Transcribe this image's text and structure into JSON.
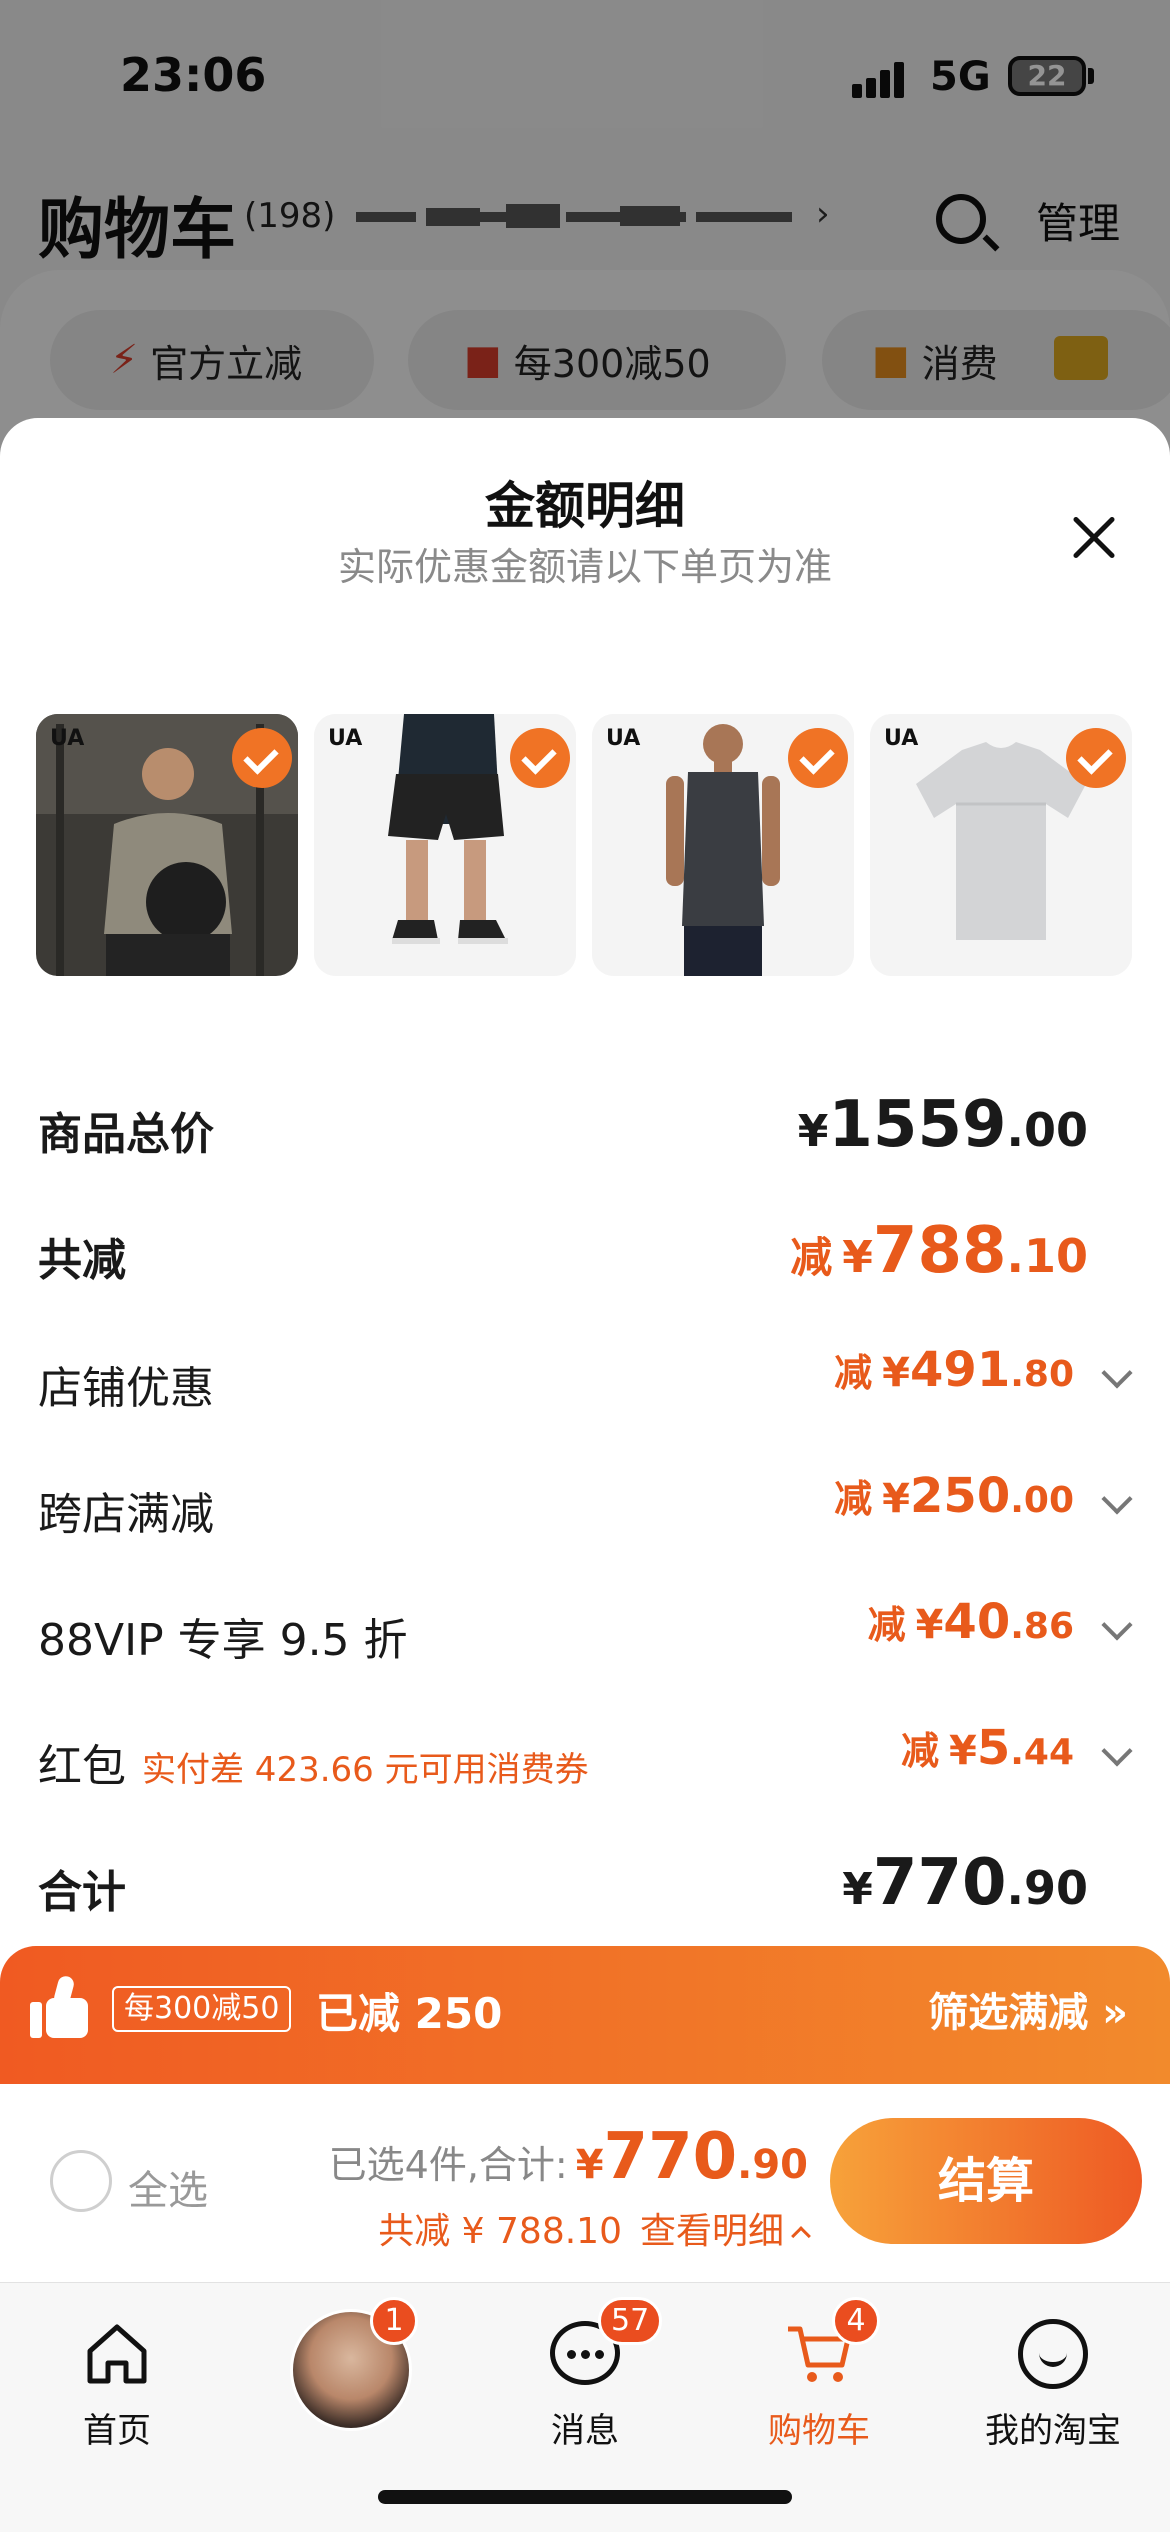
{
  "status_bar": {
    "time": "23:06",
    "network": "5G",
    "battery": "22"
  },
  "background_page": {
    "title": "购物车",
    "count": "(198)",
    "manage": "管理",
    "chips": [
      "官方立减",
      "每300减50",
      "消费"
    ]
  },
  "sheet": {
    "title": "金额明细",
    "subtitle": "实际优惠金额请以下单页为准",
    "products": [
      {
        "brand": "UA",
        "selected": true
      },
      {
        "brand": "UA",
        "selected": true
      },
      {
        "brand": "UA",
        "selected": true
      },
      {
        "brand": "UA",
        "selected": true
      }
    ],
    "rows": {
      "total": {
        "label": "商品总价",
        "symbol": "¥",
        "int": "1559",
        "dec": ".00"
      },
      "discount": {
        "label": "共减",
        "prefix": "减",
        "symbol": "¥",
        "int": "788",
        "dec": ".10"
      },
      "shop": {
        "label": "店铺优惠",
        "prefix": "减",
        "symbol": "¥",
        "int": "491",
        "dec": ".80"
      },
      "cross": {
        "label": "跨店满减",
        "prefix": "减",
        "symbol": "¥",
        "int": "250",
        "dec": ".00"
      },
      "vip": {
        "label": "88VIP 专享 9.5 折",
        "prefix": "减",
        "symbol": "¥",
        "int": "40",
        "dec": ".86"
      },
      "redpack": {
        "label": "红包",
        "note": "实付差 423.66 元可用消费券",
        "prefix": "减",
        "symbol": "¥",
        "int": "5",
        "dec": ".44"
      },
      "sum": {
        "label": "合计",
        "symbol": "¥",
        "int": "770",
        "dec": ".90"
      }
    }
  },
  "promo": {
    "tag": "每300减50",
    "text": "已减 250",
    "link": "筛选满减 »"
  },
  "checkout": {
    "select_all": "全选",
    "selected_text": "已选4件,合计:",
    "symbol": "¥",
    "int": "770",
    "dec": ".90",
    "discount_text": "共减 ¥ 788.10",
    "detail_link": "查看明细",
    "button": "结算"
  },
  "tabbar": [
    {
      "label": "首页",
      "badge": ""
    },
    {
      "label": "",
      "badge": "1"
    },
    {
      "label": "消息",
      "badge": "57"
    },
    {
      "label": "购物车",
      "badge": "4"
    },
    {
      "label": "我的淘宝",
      "badge": ""
    }
  ],
  "colors": {
    "accent": "#e85a1b",
    "check": "#f07325",
    "promo_start": "#f05a22",
    "promo_end": "#f28a2c"
  }
}
